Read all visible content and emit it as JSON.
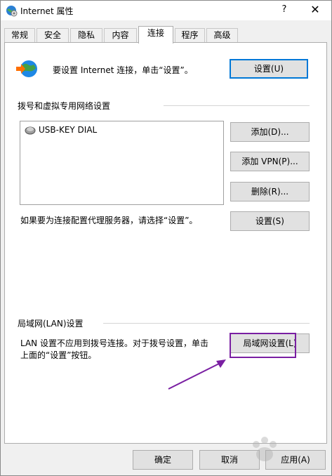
{
  "window": {
    "title": "Internet 属性",
    "help_glyph": "?",
    "close_glyph": "✕"
  },
  "tabs": [
    {
      "label": "常规"
    },
    {
      "label": "安全"
    },
    {
      "label": "隐私"
    },
    {
      "label": "内容"
    },
    {
      "label": "连接",
      "active": true
    },
    {
      "label": "程序"
    },
    {
      "label": "高级"
    }
  ],
  "setup": {
    "text": "要设置 Internet 连接，单击“设置”。",
    "button": "设置(U)"
  },
  "dialup": {
    "group_label": "拨号和虚拟专用网络设置",
    "connections": [
      "USB-KEY DIAL"
    ],
    "add_button": "添加(D)...",
    "add_vpn_button": "添加 VPN(P)...",
    "remove_button": "删除(R)...",
    "proxy_text": "如果要为连接配置代理服务器，请选择“设置”。",
    "settings_button": "设置(S)"
  },
  "lan": {
    "group_label": "局域网(LAN)设置",
    "text_line1": "LAN 设置不应用到拨号连接。对于拨号设置，单击",
    "text_line2": "上面的“设置”按钮。",
    "button": "局域网设置(L)"
  },
  "footer": {
    "ok": "确定",
    "cancel": "取消",
    "apply": "应用(A)"
  },
  "colors": {
    "annotation": "#7a1fa2",
    "focus": "#0078d7"
  }
}
